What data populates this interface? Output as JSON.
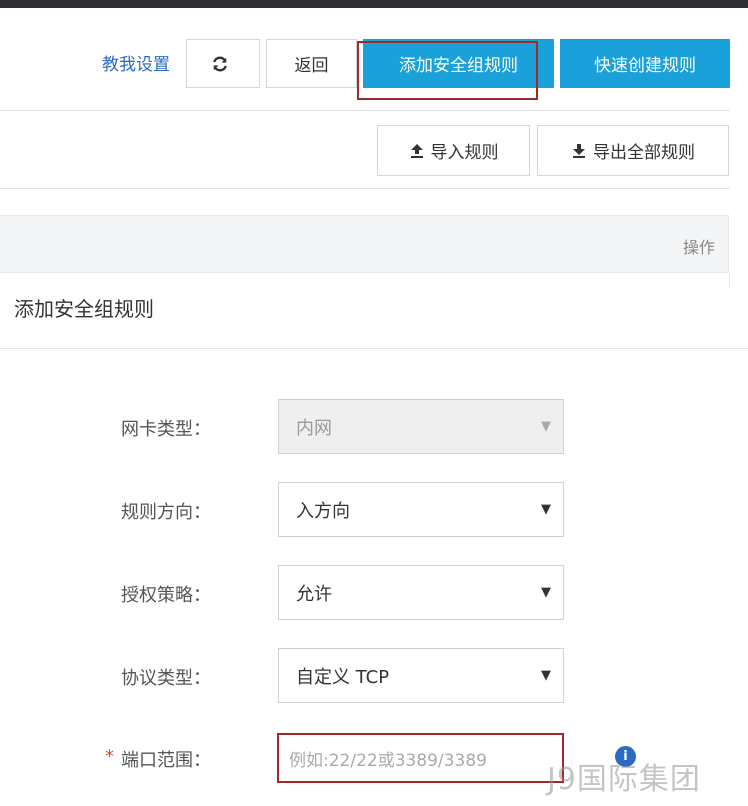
{
  "toolbar": {
    "help_link": "教我设置",
    "back_label": "返回",
    "add_rule_label": "添加安全组规则",
    "quick_create_label": "快速创建规则",
    "import_label": "导入规则",
    "export_label": "导出全部规则"
  },
  "table": {
    "operation_header": "操作"
  },
  "dialog": {
    "title": "添加安全组规则",
    "fields": {
      "nic_type": {
        "label": "网卡类型：",
        "value": "内网"
      },
      "direction": {
        "label": "规则方向：",
        "value": "入方向"
      },
      "policy": {
        "label": "授权策略：",
        "value": "允许"
      },
      "protocol": {
        "label": "协议类型：",
        "value": "自定义 TCP"
      },
      "port_range": {
        "required_mark": "*",
        "label": "端口范围：",
        "placeholder": "例如:22/22或3389/3389"
      }
    }
  },
  "watermark": "J9国际集团",
  "colors": {
    "primary": "#1aa1d9",
    "link": "#2a6cc0",
    "highlight": "#a02a2a",
    "required": "#e0483d"
  },
  "icons": {
    "refresh": "refresh-icon",
    "upload": "upload-icon",
    "download": "download-icon",
    "info": "info-icon",
    "caret": "caret-down-icon"
  }
}
